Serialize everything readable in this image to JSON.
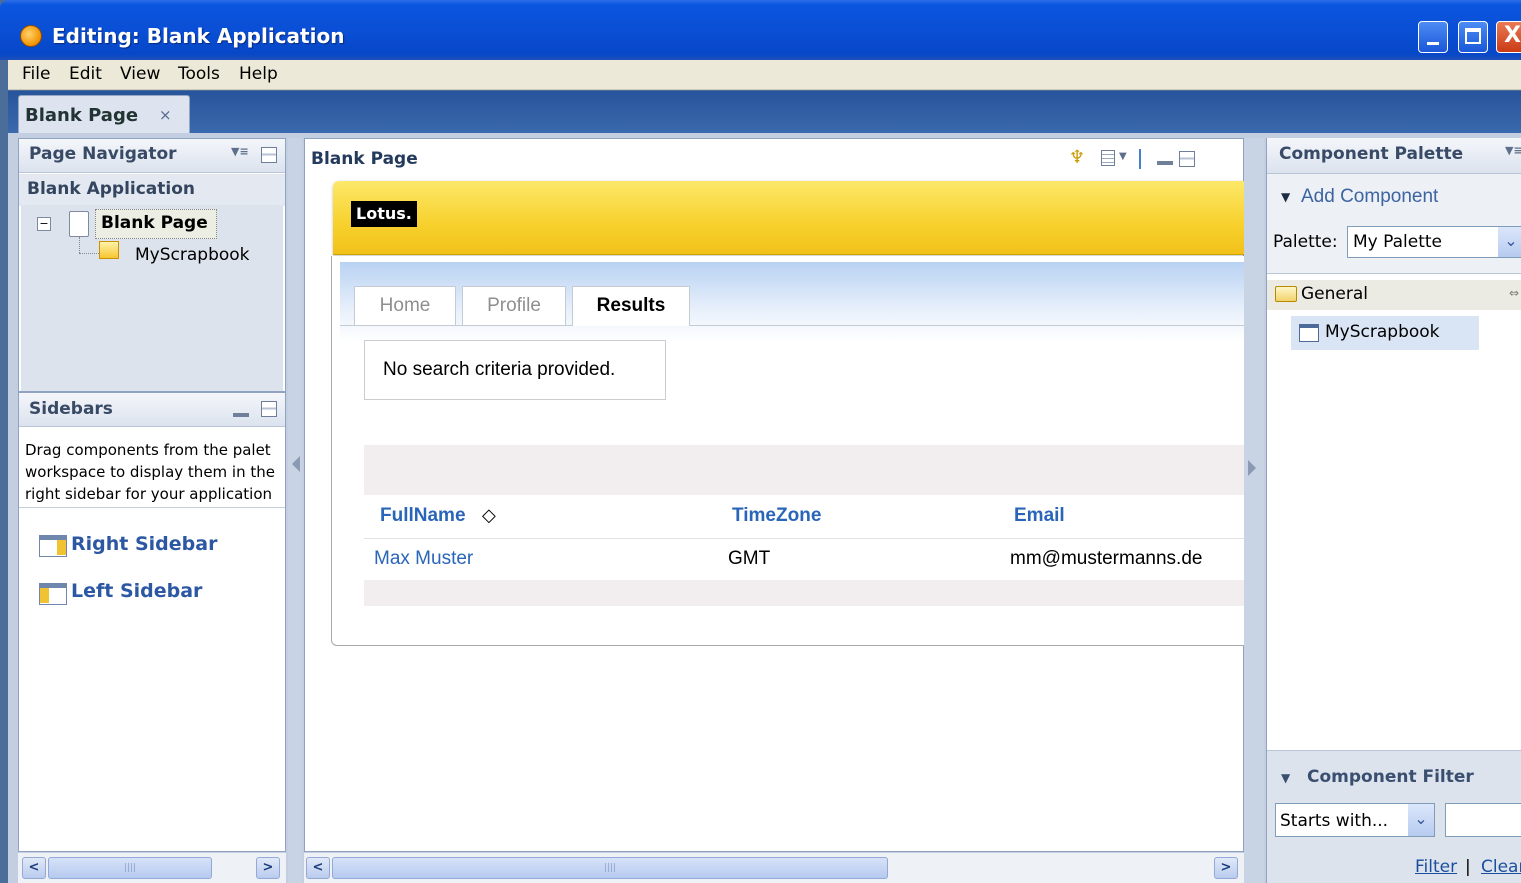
{
  "window": {
    "title": "Editing: Blank Application",
    "controls": {
      "minimize": "_",
      "maximize": "□",
      "close": "X"
    }
  },
  "menubar": {
    "items": [
      "File",
      "Edit",
      "View",
      "Tools",
      "Help"
    ]
  },
  "editor_tabs": [
    {
      "label": "Blank Page",
      "close": "×"
    }
  ],
  "page_navigator": {
    "title": "Page Navigator",
    "application": "Blank Application",
    "tree": {
      "toggle": "⊟",
      "page": "Blank Page",
      "child": "MyScrapbook"
    }
  },
  "sidebars": {
    "title": "Sidebars",
    "help_lines": [
      "Drag components from the palet",
      "workspace to display them in the",
      "right sidebar for your application"
    ],
    "items": [
      "Right Sidebar",
      "Left Sidebar"
    ]
  },
  "center": {
    "title": "Blank Page",
    "logo": "Lotus.",
    "tabs": [
      {
        "label": "Home",
        "active": false
      },
      {
        "label": "Profile",
        "active": false
      },
      {
        "label": "Results",
        "active": true
      }
    ],
    "message": "No search criteria provided.",
    "table": {
      "columns": [
        "FullName",
        "TimeZone",
        "Email"
      ],
      "sort_glyph": "◇",
      "rows": [
        [
          "Max Muster",
          "GMT",
          "mm@mustermanns.de"
        ]
      ]
    }
  },
  "palette": {
    "title": "Component Palette",
    "add_component": "Add Component",
    "palette_label": "Palette:",
    "palette_value": "My Palette",
    "category": "General",
    "items": [
      "MyScrapbook"
    ],
    "filter": {
      "title": "Component Filter",
      "mode": "Starts with...",
      "value": "",
      "filter_link": "Filter",
      "separator": "|",
      "clear_link": "Clear"
    }
  },
  "scrollbar": {
    "left": "<",
    "right": ">",
    "grip": "||||"
  },
  "colors": {
    "title_bar": "#0a4fd5",
    "accent": "#2965b8",
    "banner": "#f7d12c"
  }
}
